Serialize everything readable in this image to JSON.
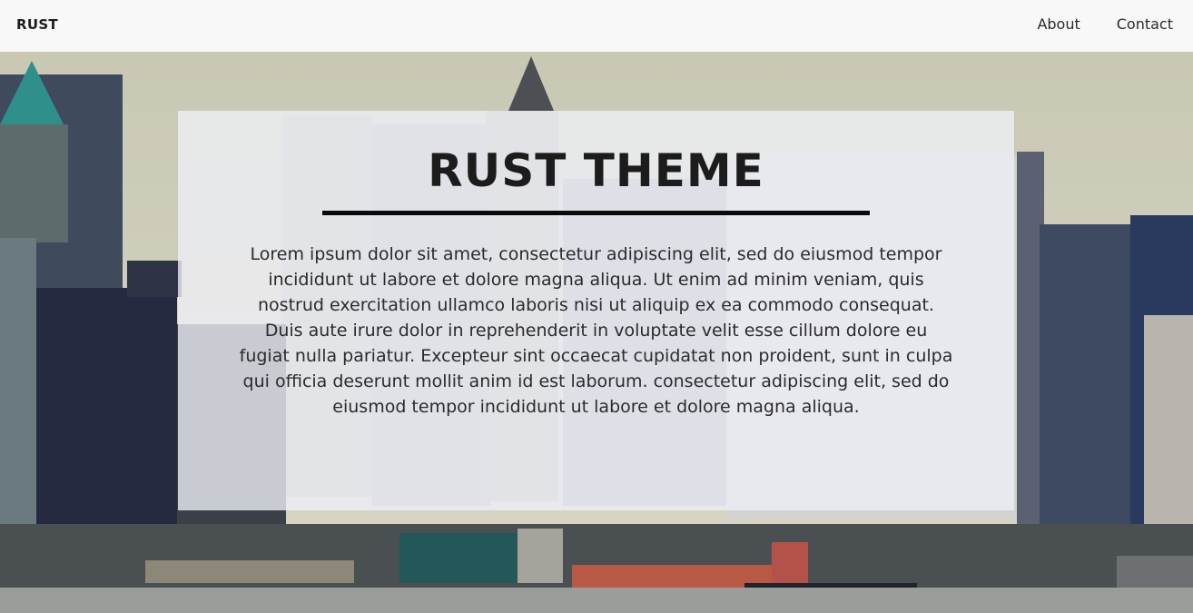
{
  "navbar": {
    "brand": "RUST",
    "links": [
      {
        "label": "About"
      },
      {
        "label": "Contact"
      }
    ]
  },
  "hero": {
    "title": "RUST THEME",
    "body": "Lorem ipsum dolor sit amet, consectetur adipiscing elit, sed do eiusmod tempor incididunt ut labore et dolore magna aliqua. Ut enim ad minim veniam, quis nostrud exercitation ullamco laboris nisi ut aliquip ex ea commodo consequat. Duis aute irure dolor in reprehenderit in voluptate velit esse cillum dolore eu fugiat nulla pariatur. Excepteur sint occaecat cupidatat non proident, sunt in culpa qui officia deserunt mollit anim id est laborum. consectetur adipiscing elit, sed do eiusmod tempor incididunt ut labore et dolore magna aliqua."
  },
  "colors": {
    "navbar_bg": "#f8f8f8",
    "card_bg": "#eeeff5",
    "title": "#1c1c1c",
    "divider": "#0a0a0a"
  },
  "icons": {
    "background": "city-skyline-photo"
  }
}
